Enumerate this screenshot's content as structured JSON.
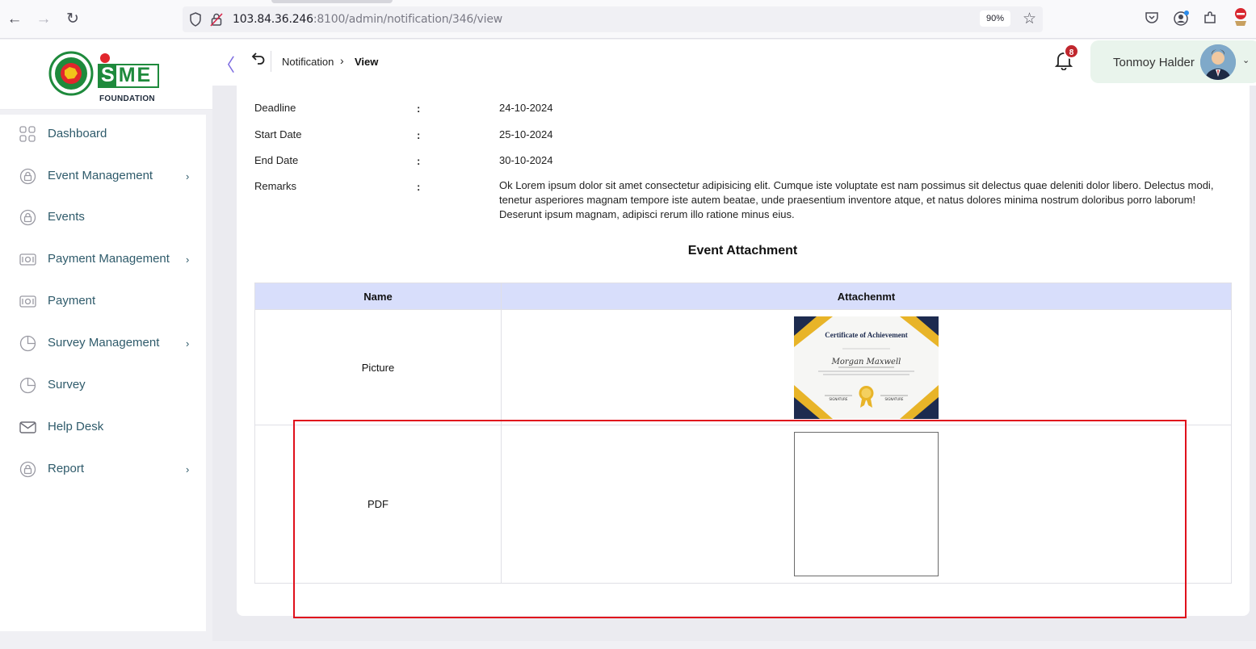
{
  "browser": {
    "url_host": "103.84.36.246",
    "url_rest": ":8100/admin/notification/346/view",
    "zoom": "90%"
  },
  "brand": {
    "logo_text": "SME",
    "logo_sub": "FOUNDATION"
  },
  "sidebar": {
    "items": [
      {
        "label": "Dashboard",
        "icon": "grid-icon",
        "has_submenu": false
      },
      {
        "label": "Event Management",
        "icon": "lock-circle-icon",
        "has_submenu": true
      },
      {
        "label": "Events",
        "icon": "lock-circle-icon",
        "has_submenu": false
      },
      {
        "label": "Payment Management",
        "icon": "cash-icon",
        "has_submenu": true
      },
      {
        "label": "Payment",
        "icon": "cash-icon",
        "has_submenu": false
      },
      {
        "label": "Survey Management",
        "icon": "pie-chart-icon",
        "has_submenu": true
      },
      {
        "label": "Survey",
        "icon": "pie-chart-icon",
        "has_submenu": false
      },
      {
        "label": "Help Desk",
        "icon": "mail-icon",
        "has_submenu": false
      },
      {
        "label": "Report",
        "icon": "lock-circle-icon",
        "has_submenu": true
      }
    ]
  },
  "header": {
    "breadcrumb_parent": "Notification",
    "breadcrumb_current": "View",
    "notification_count": "8",
    "user_name": "Tonmoy Halder"
  },
  "details": {
    "colon": ":",
    "deadline_label": "Deadline",
    "deadline_value": "24-10-2024",
    "start_label": "Start Date",
    "start_value": "25-10-2024",
    "end_label": "End Date",
    "end_value": "30-10-2024",
    "remarks_label": "Remarks",
    "remarks_value": "Ok Lorem ipsum dolor sit amet consectetur adipisicing elit. Cumque iste voluptate est nam possimus sit delectus quae deleniti dolor libero. Delectus modi, tenetur asperiores magnam tempore iste autem beatae, unde praesentium inventore atque, et natus dolores minima nostrum doloribus porro laborum! Deserunt ipsum magnam, adipisci rerum illo ratione minus eius."
  },
  "attachments": {
    "title": "Event Attachment",
    "col_name": "Name",
    "col_attachment": "Attachenmt",
    "rows": [
      {
        "name": "Picture",
        "certificate_title": "Certificate of Achievement",
        "certificate_name": "Morgan Maxwell",
        "cert_sign_left": "SIGNATURE",
        "cert_sign_right": "SIGNATURE"
      },
      {
        "name": "PDF"
      }
    ]
  },
  "colors": {
    "accent": "#7d6ce0",
    "sidebar_text": "#2f5b6b",
    "table_header": "#d8defb",
    "highlight": "#e0101c",
    "badge": "#c0262d"
  }
}
